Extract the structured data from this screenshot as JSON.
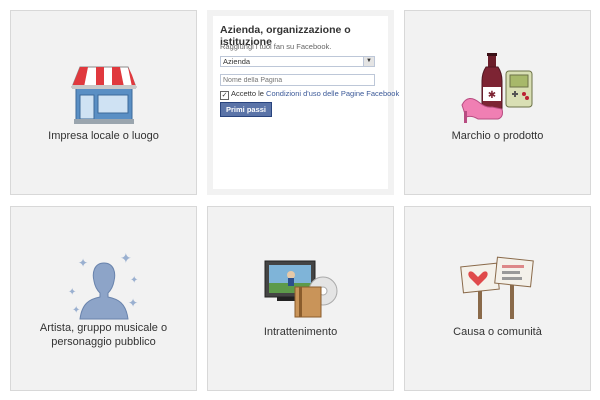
{
  "categories": [
    {
      "label": "Impresa locale o luogo",
      "icon": "storefront-icon"
    },
    {
      "label": "Marchio o prodotto",
      "icon": "brand-product-icon"
    },
    {
      "label": "Artista, gruppo musicale o personaggio pubblico",
      "icon": "artist-silhouette-icon"
    },
    {
      "label": "Intrattenimento",
      "icon": "entertainment-icon"
    },
    {
      "label": "Causa o comunità",
      "icon": "cause-signs-icon"
    }
  ],
  "form": {
    "title": "Azienda, organizzazione o istituzione",
    "subtitle": "Raggiungi i tuoi fan su Facebook.",
    "select_value": "Azienda",
    "page_name_placeholder": "Nome della Pagina",
    "accept_text": "Accetto le",
    "terms_link": "Condizioni d'uso delle Pagine Facebook",
    "checked": true,
    "submit_label": "Primi passi"
  },
  "colors": {
    "tile_bg": "#f2f2f2",
    "facebook_blue": "#3b5998",
    "button_blue": "#5b74a8"
  }
}
